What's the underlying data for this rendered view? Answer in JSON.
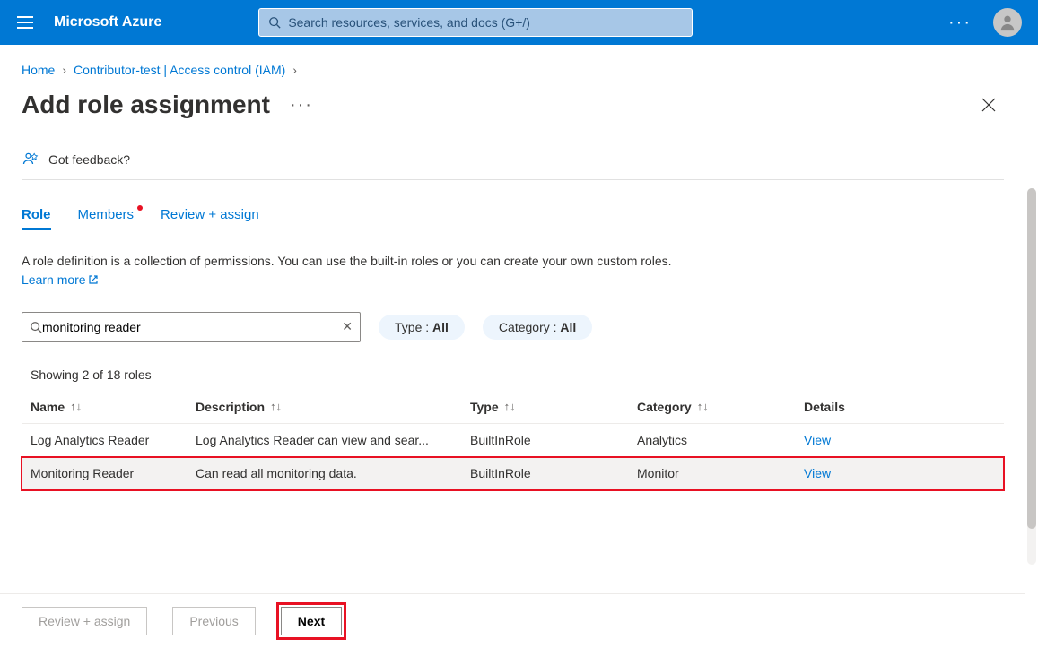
{
  "topbar": {
    "brand": "Microsoft Azure",
    "search_placeholder": "Search resources, services, and docs (G+/)"
  },
  "breadcrumb": {
    "home": "Home",
    "item1": "Contributor-test | Access control (IAM)"
  },
  "page": {
    "title": "Add role assignment",
    "feedback": "Got feedback?"
  },
  "tabs": {
    "role": "Role",
    "members": "Members",
    "review": "Review + assign"
  },
  "description": {
    "text": "A role definition is a collection of permissions. You can use the built-in roles or you can create your own custom roles. ",
    "learn_more": "Learn more"
  },
  "filters": {
    "search_value": "monitoring reader",
    "type_label": "Type : ",
    "type_value": "All",
    "category_label": "Category : ",
    "category_value": "All"
  },
  "results": {
    "count_text": "Showing 2 of 18 roles"
  },
  "table": {
    "headers": {
      "name": "Name",
      "description": "Description",
      "type": "Type",
      "category": "Category",
      "details": "Details"
    },
    "rows": [
      {
        "name": "Log Analytics Reader",
        "description": "Log Analytics Reader can view and sear...",
        "type": "BuiltInRole",
        "category": "Analytics",
        "view": "View"
      },
      {
        "name": "Monitoring Reader",
        "description": "Can read all monitoring data.",
        "type": "BuiltInRole",
        "category": "Monitor",
        "view": "View"
      }
    ]
  },
  "footer": {
    "review": "Review + assign",
    "previous": "Previous",
    "next": "Next"
  }
}
